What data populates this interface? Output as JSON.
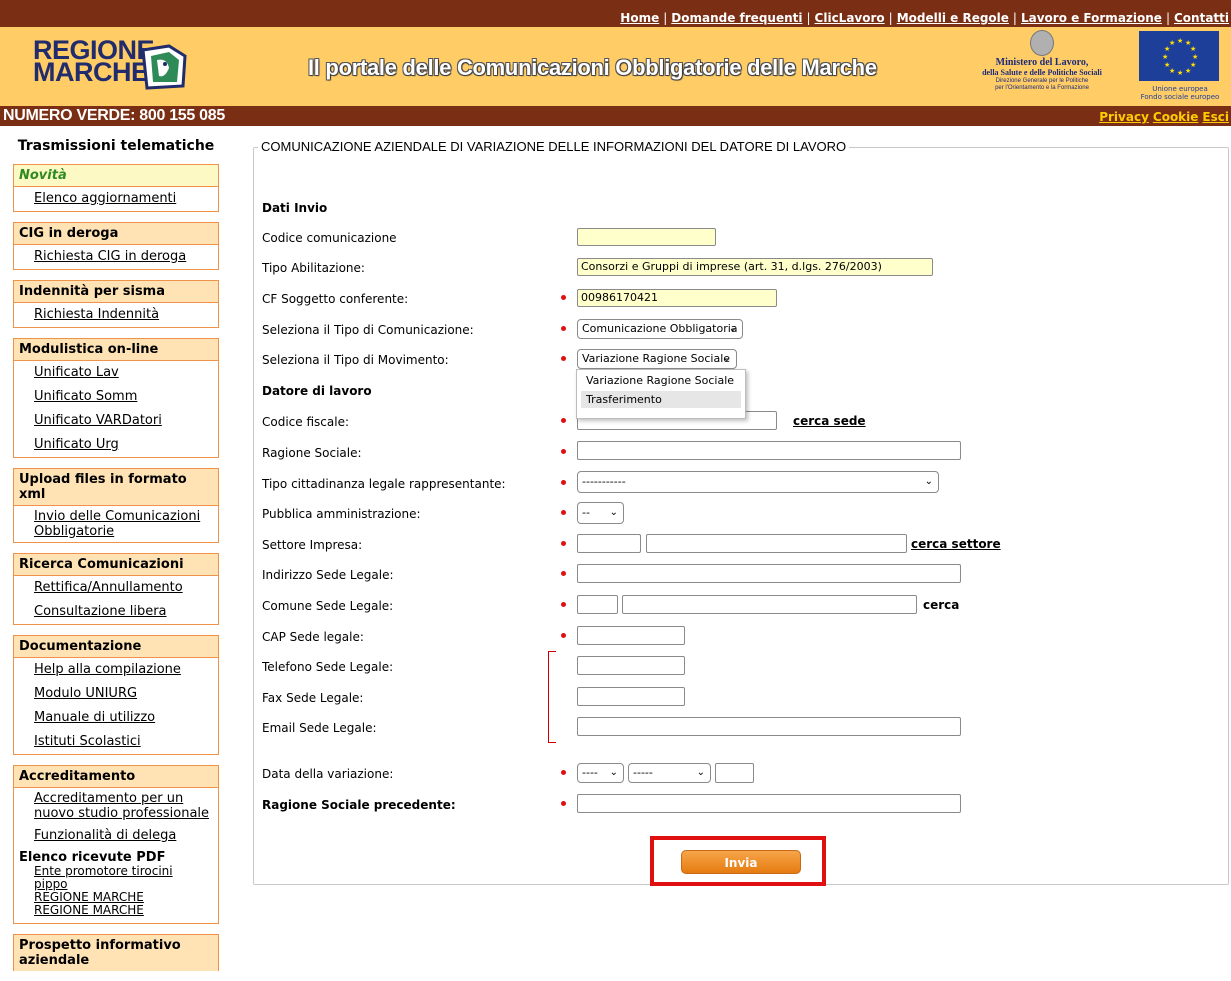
{
  "top_links": [
    "Home",
    "Domande frequenti",
    "ClicLavoro",
    "Modelli e Regole",
    "Lavoro e Formazione",
    "Contatti"
  ],
  "header": {
    "logo_line1": "REGIONE",
    "logo_line2": "MARCHE",
    "title": "Il portale delle Comunicazioni Obbligatorie delle Marche",
    "ministero_line1": "Ministero del Lavoro,",
    "ministero_line2": "della Salute e delle Politiche Sociali",
    "ministero_line3": "Direzione Generale per le Politiche",
    "ministero_line4": "per l'Orientamento e la Formazione",
    "eu_text1": "Unione europea",
    "eu_text2": "Fondo sociale europeo"
  },
  "numero_verde": "NUMERO VERDE: 800 155 085",
  "priv_links": [
    "Privacy",
    "Cookie",
    "Esci"
  ],
  "sidebar": {
    "heading": "Trasmissioni telematiche",
    "novita": "Novità",
    "novita_item": "Elenco aggiornamenti",
    "cig_title": "CIG in deroga",
    "cig_item": "Richiesta CIG in deroga",
    "sisma_title": "Indennità per sisma",
    "sisma_item": "Richiesta Indennità",
    "modulistica_title": "Modulistica on-line",
    "modulistica_items": [
      "Unificato Lav",
      "Unificato Somm",
      "Unificato VARDatori",
      "Unificato Urg"
    ],
    "upload_title": "Upload files in formato xml",
    "upload_item": "Invio delle Comunicazioni Obbligatorie",
    "ricerca_title": "Ricerca Comunicazioni",
    "ricerca_items": [
      "Rettifica/Annullamento",
      "Consultazione libera"
    ],
    "doc_title": "Documentazione",
    "doc_items": [
      "Help alla compilazione",
      "Modulo UNIURG",
      "Manuale di utilizzo",
      "Istituti Scolastici"
    ],
    "accr_title": "Accreditamento",
    "accr_item1": "Accreditamento per un nuovo studio professionale",
    "accr_item2": "Funzionalità di delega",
    "ricevute_title": "Elenco ricevute PDF",
    "ricevute_items": [
      "Ente promotore tirocini",
      "pippo",
      "REGIONE MARCHE",
      "REGIONE MARCHE"
    ],
    "prospetto_title": "Prospetto informativo aziendale"
  },
  "form": {
    "legend": "COMUNICAZIONE AZIENDALE DI VARIAZIONE DELLE INFORMAZIONI DEL DATORE DI LAVORO",
    "dati_invio": "Dati Invio",
    "codice_comunicazione": "Codice comunicazione",
    "tipo_abilitazione": "Tipo Abilitazione:",
    "tipo_abilitazione_value": "Consorzi e Gruppi di imprese (art. 31, d.lgs. 276/2003)",
    "cf_soggetto": "CF Soggetto conferente:",
    "cf_soggetto_value": "00986170421",
    "tipo_comunicazione": "Seleziona il Tipo di Comunicazione:",
    "tipo_comunicazione_value": "Comunicazione Obbligatoria",
    "tipo_movimento": "Seleziona il Tipo di Movimento:",
    "tipo_movimento_value": "Variazione Ragione Sociale",
    "movimento_options": [
      "Variazione Ragione Sociale",
      "Trasferimento"
    ],
    "datore": "Datore di lavoro",
    "codice_fiscale": "Codice fiscale:",
    "cerca_sede": "cerca sede",
    "ragione_sociale": "Ragione Sociale:",
    "tipo_cittadinanza": "Tipo cittadinanza legale rappresentante:",
    "tipo_cittadinanza_value": "-----------",
    "pubblica_amm": "Pubblica amministrazione:",
    "pubblica_amm_value": "--",
    "settore_impresa": "Settore Impresa:",
    "cerca_settore": "cerca settore",
    "indirizzo": "Indirizzo Sede Legale:",
    "comune": "Comune Sede Legale:",
    "cerca": "cerca",
    "cap": "CAP Sede legale:",
    "telefono": "Telefono Sede Legale:",
    "fax": "Fax Sede Legale:",
    "email": "Email Sede Legale:",
    "data_variazione": "Data della variazione:",
    "data_day": "----",
    "data_month": "-----",
    "ragione_prec": "Ragione Sociale precedente:",
    "invia": "Invia"
  },
  "colors": {
    "brown": "#7a2e14",
    "header_yellow": "#ffcc66",
    "sidebar_border": "#f0934a",
    "button_orange": "#e57b10",
    "highlight_red": "#e01010"
  }
}
